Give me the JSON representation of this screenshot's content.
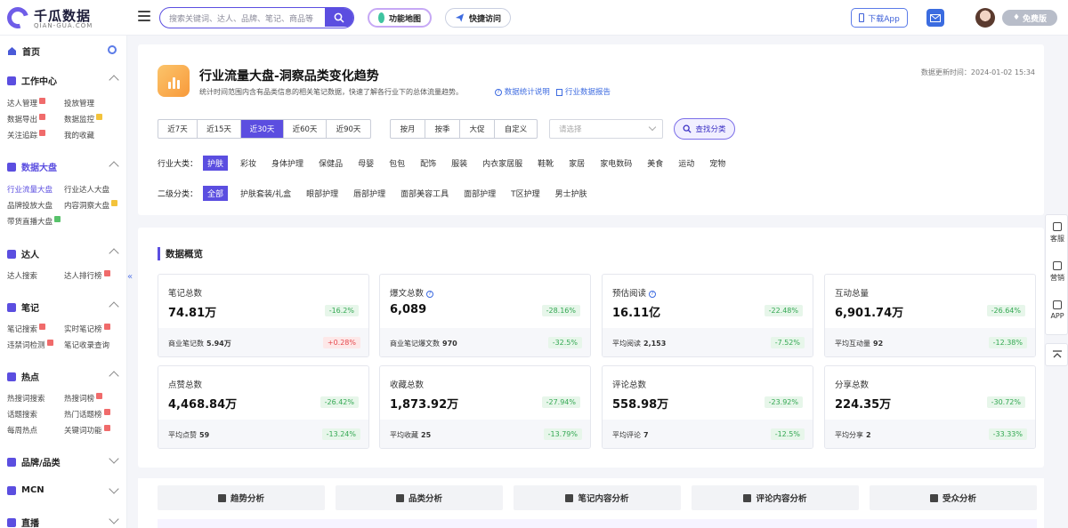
{
  "brand": {
    "name": "千瓜数据",
    "sub": "QIAN-GUA.COM"
  },
  "header": {
    "search_placeholder": "搜索关键词、达人、品牌、笔记、商品等",
    "func_map": "功能地图",
    "quick_access": "快捷访问",
    "download_app": "下载App",
    "free_version": "免费版"
  },
  "sidebar": {
    "home": "首页",
    "sections": [
      {
        "title": "工作中心",
        "items": [
          "达人管理",
          "投放管理",
          "数据导出",
          "数据监控",
          "关注追踪",
          "我的收藏"
        ]
      },
      {
        "title": "数据大盘",
        "items": [
          "行业流量大盘",
          "行业达人大盘",
          "品牌投放大盘",
          "内容洞察大盘",
          "带货直播大盘"
        ]
      },
      {
        "title": "达人",
        "items": [
          "达人搜索",
          "达人排行榜"
        ]
      },
      {
        "title": "笔记",
        "items": [
          "笔记搜索",
          "实时笔记榜",
          "违禁词检测",
          "笔记收录查询"
        ]
      },
      {
        "title": "热点",
        "items": [
          "热搜词搜索",
          "热搜词榜",
          "话题搜索",
          "热门话题榜",
          "每周热点",
          "关键词功能"
        ]
      },
      {
        "title": "品牌/品类",
        "items": []
      },
      {
        "title": "MCN",
        "items": []
      },
      {
        "title": "直播",
        "items": []
      }
    ],
    "collapse": "«"
  },
  "page": {
    "title": "行业流量大盘-洞察品类变化趋势",
    "desc": "统计时间范围内含有品类信息的相关笔记数据，快速了解各行业下的总体流量趋势。",
    "link1": "数据统计说明",
    "link2": "行业数据报告",
    "updated": "数据更新时间：2024-01-02 15:34",
    "ranges": [
      "近7天",
      "近15天",
      "近30天",
      "近60天",
      "近90天"
    ],
    "periods": [
      "按月",
      "按季",
      "大促",
      "自定义"
    ],
    "select_placeholder": "请选择",
    "find_btn": "查找分类",
    "industry_label": "行业大类：",
    "industries": [
      "护肤",
      "彩妆",
      "身体护理",
      "保健品",
      "母婴",
      "包包",
      "配饰",
      "服装",
      "内衣家居服",
      "鞋靴",
      "家居",
      "家电数码",
      "美食",
      "运动",
      "宠物"
    ],
    "sub_label": "二级分类：",
    "subs": [
      "全部",
      "护肤套装/礼盒",
      "眼部护理",
      "唇部护理",
      "面部美容工具",
      "面部护理",
      "T区护理",
      "男士护肤"
    ]
  },
  "overview": {
    "title": "数据概览",
    "stats": [
      {
        "label": "笔记总数",
        "value": "74.81万",
        "change": "-16.2%",
        "sub_label": "商业笔记数",
        "sub_value": "5.94万",
        "sub_change": "+0.28%"
      },
      {
        "label": "爆文总数",
        "value": "6,089",
        "change": "-28.16%",
        "sub_label": "商业笔记爆文数",
        "sub_value": "970",
        "sub_change": "-32.5%"
      },
      {
        "label": "预估阅读",
        "value": "16.11亿",
        "change": "-22.48%",
        "sub_label": "平均阅读",
        "sub_value": "2,153",
        "sub_change": "-7.52%"
      },
      {
        "label": "互动总量",
        "value": "6,901.74万",
        "change": "-26.64%",
        "sub_label": "平均互动量",
        "sub_value": "92",
        "sub_change": "-12.38%"
      },
      {
        "label": "点赞总数",
        "value": "4,468.84万",
        "change": "-26.42%",
        "sub_label": "平均点赞",
        "sub_value": "59",
        "sub_change": "-13.24%"
      },
      {
        "label": "收藏总数",
        "value": "1,873.92万",
        "change": "-27.94%",
        "sub_label": "平均收藏",
        "sub_value": "25",
        "sub_change": "-13.79%"
      },
      {
        "label": "评论总数",
        "value": "558.98万",
        "change": "-23.92%",
        "sub_label": "平均评论",
        "sub_value": "7",
        "sub_change": "-12.5%"
      },
      {
        "label": "分享总数",
        "value": "224.35万",
        "change": "-30.72%",
        "sub_label": "平均分享",
        "sub_value": "2",
        "sub_change": "-33.33%"
      }
    ]
  },
  "tabs": [
    "趋势分析",
    "品类分析",
    "笔记内容分析",
    "评论内容分析",
    "受众分析"
  ],
  "float": {
    "service": "客服",
    "marketing": "营销",
    "app": "APP"
  },
  "colors": {
    "accent": "#5b4ee0",
    "link": "#3d6be0",
    "down": "#34a853",
    "up": "#e5484d"
  }
}
